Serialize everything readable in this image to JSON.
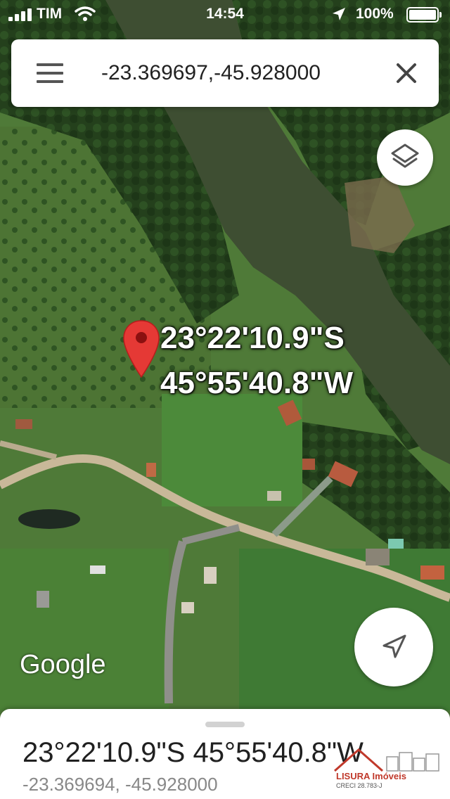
{
  "status_bar": {
    "carrier": "TIM",
    "time": "14:54",
    "battery_percent": "100%"
  },
  "search": {
    "query": "-23.369697,-45.928000",
    "menu_icon": "hamburger-menu-icon",
    "clear_icon": "close-icon"
  },
  "map": {
    "pin_lat_label": "23°22'10.9\"S",
    "pin_lng_label": "45°55'40.8\"W",
    "google_logo": "Google",
    "layers_icon": "layers-icon",
    "my_location_icon": "navigation-arrow-icon"
  },
  "bottom_sheet": {
    "title": "23°22'10.9\"S 45°55'40.8\"W",
    "subtitle": "-23.369694, -45.928000"
  },
  "watermark": {
    "brand": "LISURA Imóveis",
    "creci": "CRECI 28.783-J"
  },
  "colors": {
    "pin_red": "#e53935",
    "sheet_bg": "#ffffff",
    "river": "#3e4e32",
    "grass": "#4f7a38"
  }
}
